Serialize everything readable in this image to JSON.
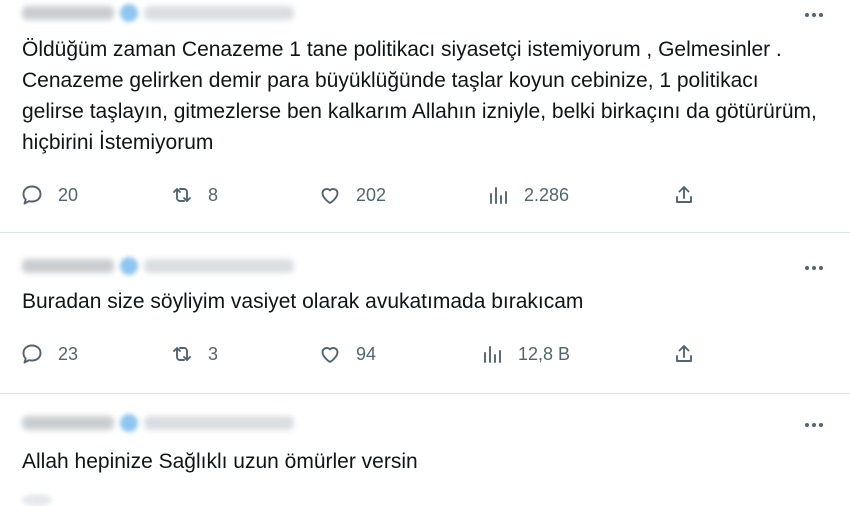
{
  "more_glyph": "•••",
  "tweets": [
    {
      "text": "Öldüğüm zaman Cenazeme  1 tane politikacı siyasetçi  istemiyorum , Gelmesinler . Cenazeme gelirken demir para büyüklüğünde taşlar koyun cebinize, 1 politikacı gelirse taşlayın, gitmezlerse ben kalkarım Allahın izniyle, belki birkaçını da götürürüm, hiçbirini İstemiyorum",
      "replies": "20",
      "retweets": "8",
      "likes": "202",
      "views": "2.286"
    },
    {
      "text": "Buradan size söyliyim vasiyet olarak avukatımada bırakıcam",
      "replies": "23",
      "retweets": "3",
      "likes": "94",
      "views": "12,8 B"
    },
    {
      "text": "Allah hepinize Sağlıklı uzun ömürler versin"
    }
  ],
  "icons": {
    "reply": "reply-icon",
    "retweet": "retweet-icon",
    "like": "heart-icon",
    "views": "views-icon",
    "share": "share-icon",
    "more": "more-icon",
    "verified": "verified-badge-icon"
  }
}
